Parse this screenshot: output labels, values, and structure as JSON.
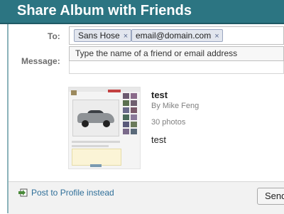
{
  "dialog": {
    "title": "Share Album with Friends",
    "accent_color": "#2c7582"
  },
  "form": {
    "to_label": "To:",
    "message_label": "Message:",
    "recipients": [
      {
        "label": "Sans Hose",
        "remove": "×"
      },
      {
        "label": "email@domain.com",
        "remove": "×"
      }
    ],
    "suggestion_text": "Type the name of a friend or email address"
  },
  "album": {
    "title": "test",
    "byline": "By Mike Feng",
    "count": "30 photos",
    "description": "test"
  },
  "footer": {
    "post_link": "Post to Profile instead",
    "send_label": "Send"
  }
}
